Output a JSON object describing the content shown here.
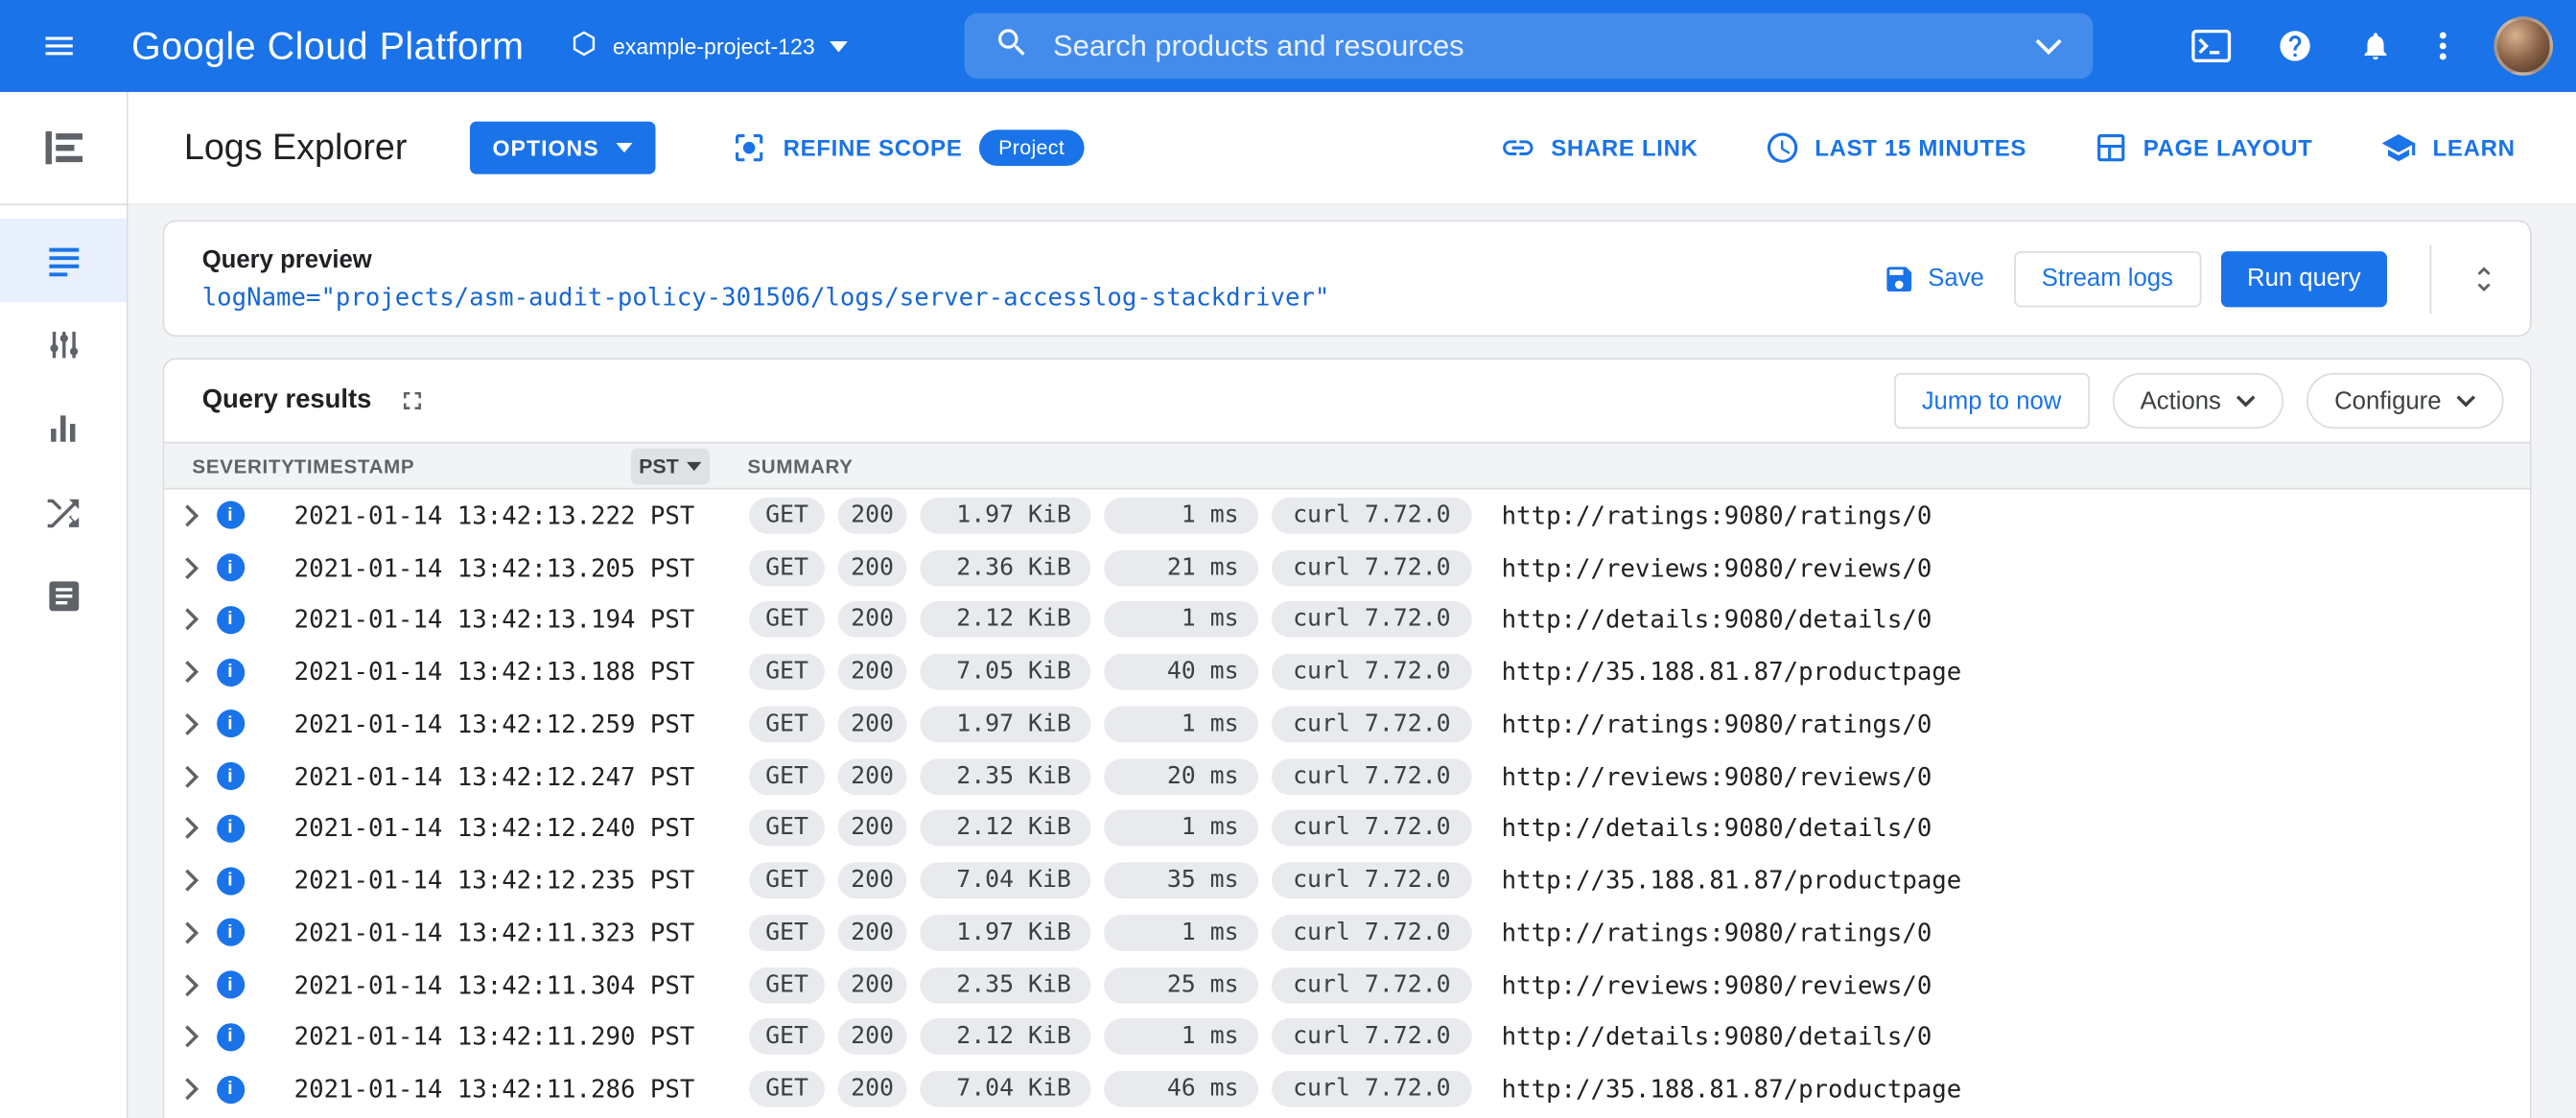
{
  "topbar": {
    "product_name": "Google Cloud Platform",
    "project_name": "example-project-123",
    "search_placeholder": "Search products and resources"
  },
  "page_header": {
    "title": "Logs Explorer",
    "options_button": "OPTIONS",
    "refine_scope": "REFINE SCOPE",
    "scope_badge": "Project",
    "actions": {
      "share_link": "SHARE LINK",
      "time_range": "LAST 15 MINUTES",
      "page_layout": "PAGE LAYOUT",
      "learn": "LEARN"
    }
  },
  "query_preview": {
    "title": "Query preview",
    "query": "logName=\"projects/asm-audit-policy-301506/logs/server-accesslog-stackdriver\"",
    "save_button": "Save",
    "stream_logs_button": "Stream logs",
    "run_query_button": "Run query"
  },
  "query_results": {
    "title": "Query results",
    "jump_to_now_button": "Jump to now",
    "actions_button": "Actions",
    "configure_button": "Configure",
    "columns": {
      "severity": "SEVERITY",
      "timestamp": "TIMESTAMP",
      "timezone": "PST",
      "summary": "SUMMARY"
    },
    "rows": [
      {
        "severity": "info",
        "timestamp": "2021-01-14 13:42:13.222 PST",
        "method": "GET",
        "status": "200",
        "size": "1.97 KiB",
        "latency": "1 ms",
        "user_agent": "curl 7.72.0",
        "url": "http://ratings:9080/ratings/0"
      },
      {
        "severity": "info",
        "timestamp": "2021-01-14 13:42:13.205 PST",
        "method": "GET",
        "status": "200",
        "size": "2.36 KiB",
        "latency": "21 ms",
        "user_agent": "curl 7.72.0",
        "url": "http://reviews:9080/reviews/0"
      },
      {
        "severity": "info",
        "timestamp": "2021-01-14 13:42:13.194 PST",
        "method": "GET",
        "status": "200",
        "size": "2.12 KiB",
        "latency": "1 ms",
        "user_agent": "curl 7.72.0",
        "url": "http://details:9080/details/0"
      },
      {
        "severity": "info",
        "timestamp": "2021-01-14 13:42:13.188 PST",
        "method": "GET",
        "status": "200",
        "size": "7.05 KiB",
        "latency": "40 ms",
        "user_agent": "curl 7.72.0",
        "url": "http://35.188.81.87/productpage"
      },
      {
        "severity": "info",
        "timestamp": "2021-01-14 13:42:12.259 PST",
        "method": "GET",
        "status": "200",
        "size": "1.97 KiB",
        "latency": "1 ms",
        "user_agent": "curl 7.72.0",
        "url": "http://ratings:9080/ratings/0"
      },
      {
        "severity": "info",
        "timestamp": "2021-01-14 13:42:12.247 PST",
        "method": "GET",
        "status": "200",
        "size": "2.35 KiB",
        "latency": "20 ms",
        "user_agent": "curl 7.72.0",
        "url": "http://reviews:9080/reviews/0"
      },
      {
        "severity": "info",
        "timestamp": "2021-01-14 13:42:12.240 PST",
        "method": "GET",
        "status": "200",
        "size": "2.12 KiB",
        "latency": "1 ms",
        "user_agent": "curl 7.72.0",
        "url": "http://details:9080/details/0"
      },
      {
        "severity": "info",
        "timestamp": "2021-01-14 13:42:12.235 PST",
        "method": "GET",
        "status": "200",
        "size": "7.04 KiB",
        "latency": "35 ms",
        "user_agent": "curl 7.72.0",
        "url": "http://35.188.81.87/productpage"
      },
      {
        "severity": "info",
        "timestamp": "2021-01-14 13:42:11.323 PST",
        "method": "GET",
        "status": "200",
        "size": "1.97 KiB",
        "latency": "1 ms",
        "user_agent": "curl 7.72.0",
        "url": "http://ratings:9080/ratings/0"
      },
      {
        "severity": "info",
        "timestamp": "2021-01-14 13:42:11.304 PST",
        "method": "GET",
        "status": "200",
        "size": "2.35 KiB",
        "latency": "25 ms",
        "user_agent": "curl 7.72.0",
        "url": "http://reviews:9080/reviews/0"
      },
      {
        "severity": "info",
        "timestamp": "2021-01-14 13:42:11.290 PST",
        "method": "GET",
        "status": "200",
        "size": "2.12 KiB",
        "latency": "1 ms",
        "user_agent": "curl 7.72.0",
        "url": "http://details:9080/details/0"
      },
      {
        "severity": "info",
        "timestamp": "2021-01-14 13:42:11.286 PST",
        "method": "GET",
        "status": "200",
        "size": "7.04 KiB",
        "latency": "46 ms",
        "user_agent": "curl 7.72.0",
        "url": "http://35.188.81.87/productpage"
      }
    ]
  },
  "colors": {
    "brand_blue": "#1a73e8",
    "query_code_blue": "#1967d2",
    "chip_background": "#e8eaed",
    "selected_nav_background": "#e8f0fe",
    "border_gray": "#dadce0",
    "table_header_background": "#f1f3f4",
    "text_dark": "#202124",
    "text_gray": "#5f6368"
  },
  "icons": {
    "menu": "hamburger",
    "project": "hexagon",
    "search": "magnifier",
    "cloud_shell": "terminal-prompt",
    "help": "question-circle",
    "notifications": "bell",
    "more": "kebab-dots",
    "refine_scope": "center-focus",
    "share_link": "chain-link",
    "time_range": "clock",
    "page_layout": "layout-grid",
    "learn": "graduation-cap",
    "save": "floppy-disk",
    "expand_editor": "unfold-more",
    "fullscreen": "corner-brackets",
    "severity_info": "blue-circle-i",
    "row_expand": "chevron-right",
    "dropdown": "caret-down"
  }
}
